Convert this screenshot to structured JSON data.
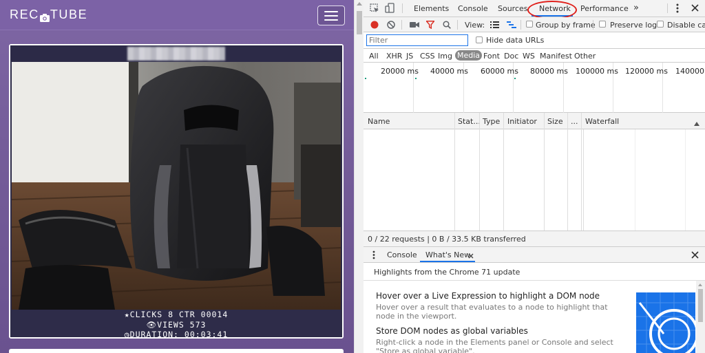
{
  "site": {
    "logo_left": "REC",
    "logo_right": "TUBE",
    "card": {
      "clicks_line": "★CLICKS 8 CTR 00014",
      "views_line": "VIEWS 573",
      "duration_line": "DURATION: 00:03:41"
    }
  },
  "devtools": {
    "main_tabs": [
      "Elements",
      "Console",
      "Sources",
      "Network",
      "Performance"
    ],
    "active_tab": "Network",
    "overflow_tabs": "»",
    "toolbar": {
      "view_label": "View:",
      "group_by_frame": "Group by frame",
      "preserve_log": "Preserve log",
      "disable_cache": "Disable cac"
    },
    "filter": {
      "placeholder": "Filter",
      "hide_data_urls": "Hide data URLs"
    },
    "type_filters": [
      "All",
      "XHR",
      "JS",
      "CSS",
      "Img",
      "Media",
      "Font",
      "Doc",
      "WS",
      "Manifest",
      "Other"
    ],
    "active_type": "Media",
    "timeline_labels": [
      "20000 ms",
      "40000 ms",
      "60000 ms",
      "80000 ms",
      "100000 ms",
      "120000 ms",
      "140000 r"
    ],
    "columns": [
      "Name",
      "Stat...",
      "Type",
      "Initiator",
      "Size",
      "...",
      "Waterfall"
    ],
    "summary": "0 / 22 requests  |  0 B / 33.5 KB transferred",
    "drawer": {
      "tabs": [
        "Console",
        "What's New"
      ],
      "active_tab": "What's New",
      "subtitle": "Highlights from the Chrome 71 update",
      "items": [
        {
          "heading": "Hover over a Live Expression to highlight a DOM node",
          "desc1": "Hover over a result that evaluates to a node to highlight that",
          "desc2": "node in the viewport."
        },
        {
          "heading": "Store DOM nodes as global variables",
          "desc1": "Right-click a node in the Elements panel or Console and select",
          "desc2": "\"Store as global variable\"."
        }
      ]
    }
  },
  "colors": {
    "site_purple": "#7c62a6",
    "card_dark": "#2c2a47",
    "record_red": "#d93025",
    "annotation_red": "#e0201b",
    "chrome_blue": "#1a73e8"
  },
  "icons": [
    "menu-icon",
    "camera-icon",
    "inspect-icon",
    "device-toolbar-icon",
    "record-icon",
    "clear-icon",
    "capture-screenshots-icon",
    "filter-icon",
    "search-icon",
    "large-rows-icon",
    "waterfall-view-icon",
    "more-icon",
    "close-icon",
    "sort-up-icon",
    "star-icon",
    "eye-icon",
    "clock-icon"
  ]
}
